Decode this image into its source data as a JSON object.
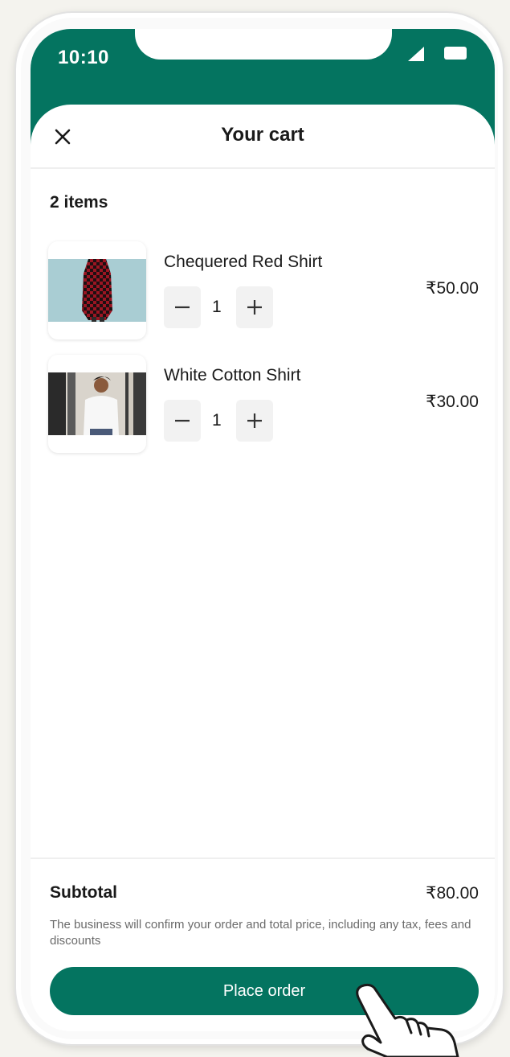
{
  "status_bar": {
    "time": "10:10",
    "icons": [
      "signal-icon",
      "battery-icon"
    ]
  },
  "header": {
    "title": "Your cart",
    "close_icon": "close-icon"
  },
  "cart": {
    "item_count_label": "2 items",
    "items": [
      {
        "name": "Chequered Red Shirt",
        "quantity": "1",
        "price": "₹50.00",
        "image": "chequered-red-shirt-photo"
      },
      {
        "name": "White Cotton Shirt",
        "quantity": "1",
        "price": "₹30.00",
        "image": "white-cotton-shirt-photo"
      }
    ]
  },
  "footer": {
    "subtotal_label": "Subtotal",
    "subtotal_value": "₹80.00",
    "note": "The business will confirm your order and total price, including any tax, fees and discounts",
    "place_order_label": "Place order"
  },
  "colors": {
    "brand": "#047460",
    "background": "#f4f3ee",
    "text": "#1a1a1a",
    "muted_text": "#6b6b6b"
  }
}
